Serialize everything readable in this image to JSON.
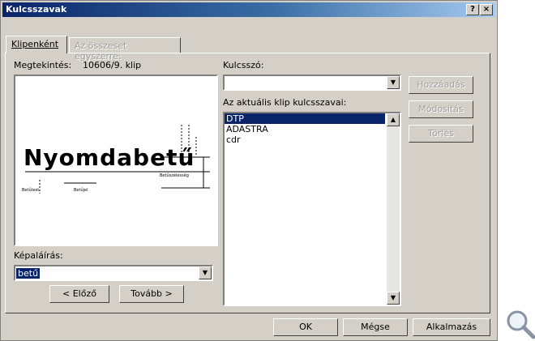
{
  "window": {
    "title": "Kulcsszavak",
    "help_label": "?",
    "close_label": "×"
  },
  "tabs": [
    {
      "label": "Klipenként"
    },
    {
      "label": "Az összeset egyszerre:"
    }
  ],
  "preview": {
    "label": "Megtekintés:",
    "clip_info": "10606/9. klip",
    "image_word": "Nyomdabetű",
    "image_caption_left": "Betűtest",
    "image_caption_mid": "Betűjel",
    "image_caption_right": "Betűszélesség"
  },
  "caption": {
    "label": "Képaláírás:",
    "value": "betű"
  },
  "nav": {
    "prev_label": "< Előző",
    "next_label": "Tovább >"
  },
  "keyword": {
    "label": "Kulcsszó:",
    "value": ""
  },
  "keywords_list": {
    "label": "Az aktuális klip kulcsszavai:",
    "items": [
      "DTP",
      "ADASTRA",
      "cdr"
    ]
  },
  "side_buttons": {
    "add_label": "Hozzáadás",
    "modify_label": "Módosítás",
    "delete_label": "Törlés"
  },
  "footer": {
    "ok_label": "OK",
    "cancel_label": "Mégse",
    "apply_label": "Alkalmazás"
  }
}
